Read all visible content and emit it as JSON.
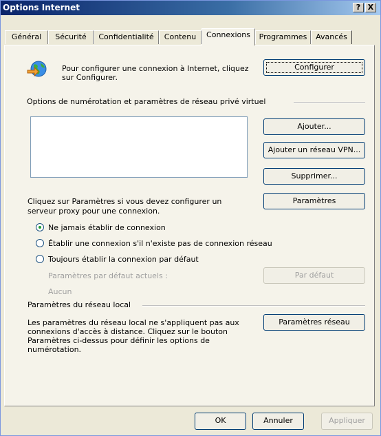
{
  "window": {
    "title": "Options Internet",
    "help_label": "?",
    "close_label": "X"
  },
  "tabs": [
    {
      "label": "Général"
    },
    {
      "label": "Sécurité"
    },
    {
      "label": "Confidentialité"
    },
    {
      "label": "Contenu"
    },
    {
      "label": "Connexions"
    },
    {
      "label": "Programmes"
    },
    {
      "label": "Avancés"
    }
  ],
  "active_tab": "Connexions",
  "setup": {
    "text_line1": "Pour configurer une connexion à Internet, cliquez",
    "text_line2": "sur Configurer.",
    "button_label": "Configurer",
    "icon": "globe-connection-icon"
  },
  "dialup": {
    "section_label": "Options de numérotation et paramètres de réseau privé virtuel",
    "list_items": [],
    "add_button": "Ajouter...",
    "add_vpn_button": "Ajouter un réseau VPN...",
    "remove_button": "Supprimer...",
    "settings_text_line1": "Cliquez sur Paramètres si vous devez configurer un",
    "settings_text_line2": "serveur proxy pour une connexion.",
    "settings_button": "Paramètres",
    "radios": [
      {
        "label": "Ne jamais établir de connexion",
        "selected": true
      },
      {
        "label": "Établir une connexion s'il n'existe pas de connexion réseau",
        "selected": false
      },
      {
        "label": "Toujours établir la connexion par défaut",
        "selected": false
      }
    ],
    "default_label": "Paramètres par défaut actuels :",
    "default_value": "Aucun",
    "default_button": "Par défaut"
  },
  "lan": {
    "section_label": "Paramètres du réseau local",
    "text_line1": "Les paramètres du réseau local ne s'appliquent pas aux",
    "text_line2": "connexions d'accès à distance. Cliquez sur le bouton",
    "text_line3": "Paramètres ci-dessus pour définir les options de",
    "text_line4": "numérotation.",
    "button_label": "Paramètres réseau"
  },
  "footer": {
    "ok": "OK",
    "cancel": "Annuler",
    "apply": "Appliquer"
  },
  "colors": {
    "titlebar": "#0a246a",
    "dialog_bg": "#ece9d8",
    "panel_bg": "#f5f3ea",
    "button_border": "#003c74",
    "radio_dot": "#1f9e36"
  }
}
